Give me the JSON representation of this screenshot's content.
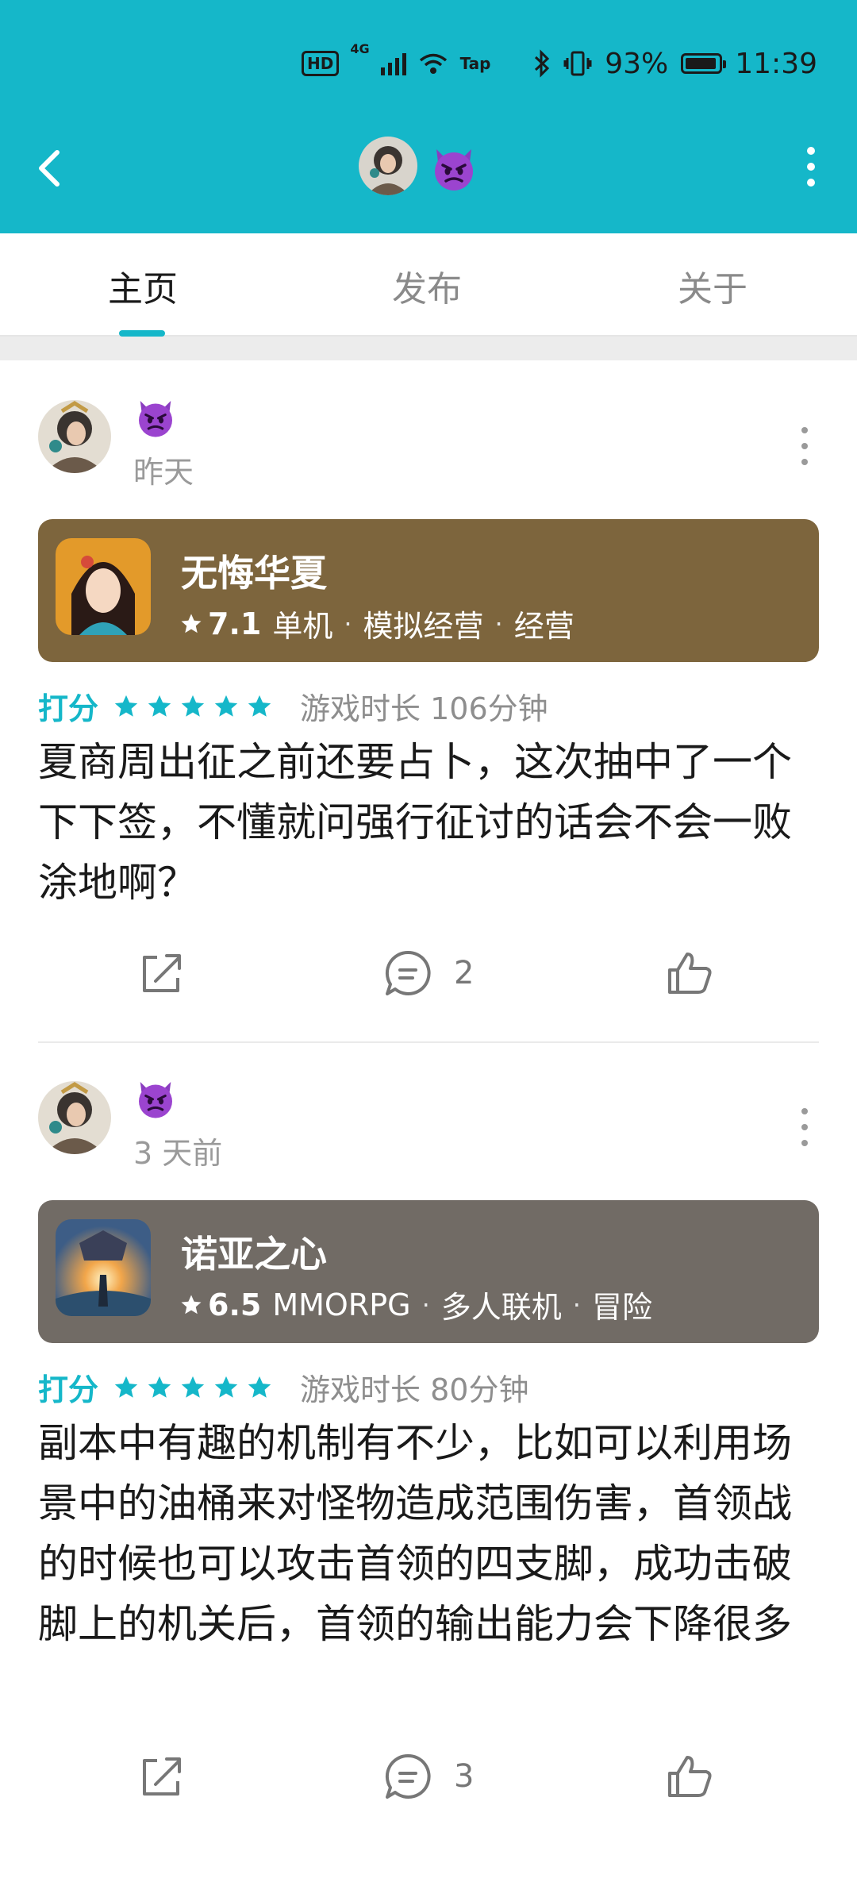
{
  "status_bar": {
    "left_hd": "HD",
    "left_network": "4G",
    "left_app": "Tap",
    "battery": "93%",
    "time": "11:39"
  },
  "header": {
    "emoji_icon": "devil-emoji"
  },
  "tabs": [
    {
      "label": "主页"
    },
    {
      "label": "发布"
    },
    {
      "label": "关于"
    }
  ],
  "posts": [
    {
      "time": "昨天",
      "game": {
        "title": "无悔华夏",
        "rating": "7.1",
        "tags": [
          "单机",
          "模拟经营",
          "经营"
        ],
        "card_color": "#7d653d"
      },
      "score_label": "打分",
      "stars": 5,
      "playtime": "游戏时长 106分钟",
      "content": "夏商周出征之前还要占卜，这次抽中了一个下下签，不懂就问强行征讨的话会不会一败涂地啊？",
      "comments": "2"
    },
    {
      "time": "3 天前",
      "game": {
        "title": "诺亚之心",
        "rating": "6.5",
        "tags": [
          "MMORPG",
          "多人联机",
          "冒险"
        ],
        "card_color": "#716b65"
      },
      "score_label": "打分",
      "stars": 5,
      "playtime": "游戏时长 80分钟",
      "content": "副本中有趣的机制有不少，比如可以利用场景中的油桶来对怪物造成范围伤害，首领战的时候也可以攻击首领的四支脚，成功击破脚上的机关后，首领的输出能力会下降很多",
      "comments": "3"
    }
  ],
  "colors": {
    "accent": "#15b7c9",
    "topbar": "#15b7c9"
  }
}
